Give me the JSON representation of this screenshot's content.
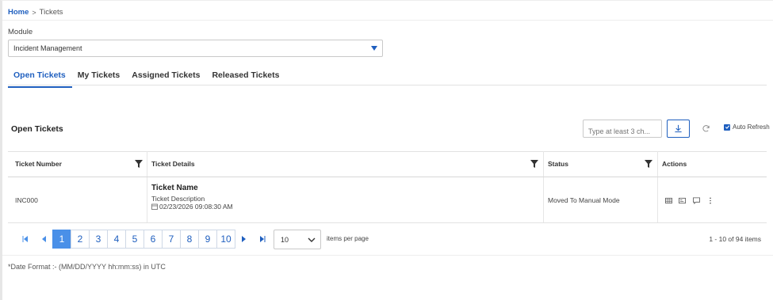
{
  "breadcrumb": {
    "home": "Home",
    "separator": ">",
    "current": "Tickets"
  },
  "module": {
    "label": "Module",
    "selected": "Incident Management"
  },
  "tabs": [
    {
      "label": "Open Tickets",
      "active": true
    },
    {
      "label": "My Tickets",
      "active": false
    },
    {
      "label": "Assigned Tickets",
      "active": false
    },
    {
      "label": "Released Tickets",
      "active": false
    }
  ],
  "section": {
    "title": "Open Tickets"
  },
  "toolbar": {
    "search_placeholder": "Type at least 3 ch...",
    "download_icon": "download-icon",
    "refresh_icon": "refresh-icon",
    "auto_refresh_label": "Auto Refresh",
    "auto_refresh_checked": true
  },
  "table": {
    "columns": [
      "Ticket Number",
      "Ticket Details",
      "Status",
      "Actions"
    ],
    "rows": [
      {
        "ticket_number": "INC000",
        "ticket_name": "Ticket Name",
        "ticket_description": "Ticket Description",
        "ticket_date": "02/23/2026 09:08:30 AM",
        "status": "Moved To Manual Mode",
        "actions": [
          "table-icon",
          "card-icon",
          "comment-icon",
          "more-vertical-icon"
        ]
      }
    ]
  },
  "pagination": {
    "pages": [
      "1",
      "2",
      "3",
      "4",
      "5",
      "6",
      "7",
      "8",
      "9",
      "10"
    ],
    "current_page": "1",
    "per_page": "10",
    "per_page_label": "items per page",
    "range_text": "1 - 10 of 94 items"
  },
  "footer": {
    "date_format_note": "*Date Format :- (MM/DD/YYYY hh:mm:ss) in UTC"
  },
  "colors": {
    "accent": "#1f5fbf",
    "active_page": "#4a90e8"
  }
}
